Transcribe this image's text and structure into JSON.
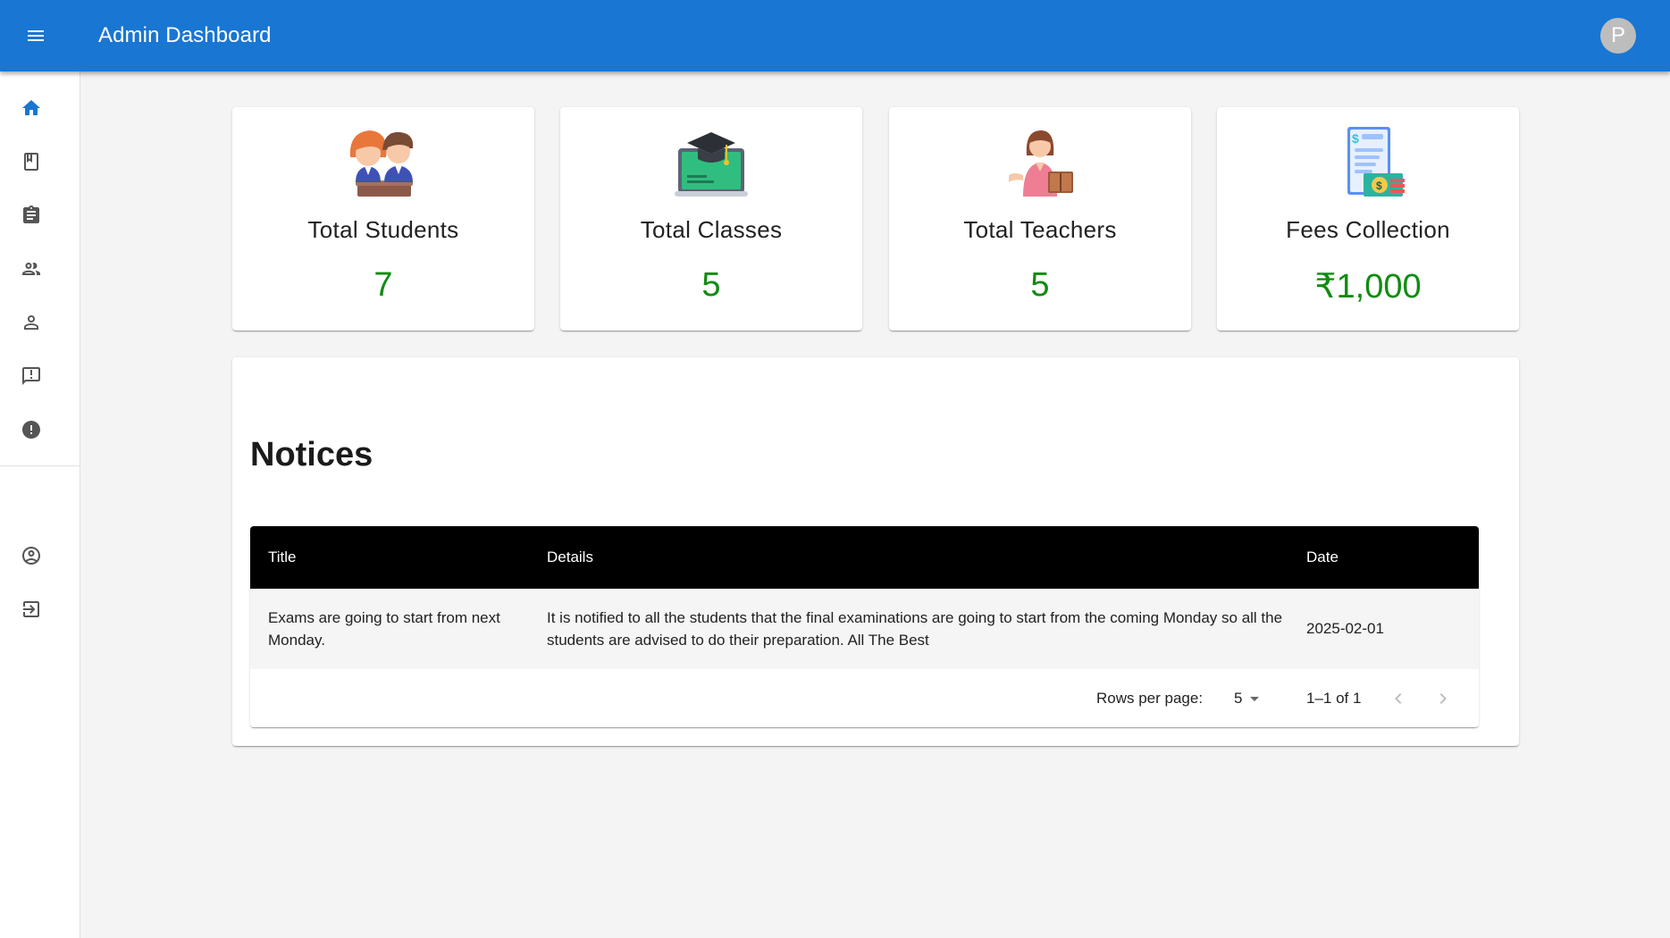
{
  "appbar": {
    "title": "Admin Dashboard",
    "avatar_initial": "P",
    "color": "#1976d2"
  },
  "sidebar": {
    "items": [
      {
        "name": "home",
        "icon": "home-icon",
        "active": true
      },
      {
        "name": "classes",
        "icon": "class-icon"
      },
      {
        "name": "subjects",
        "icon": "assignment-icon"
      },
      {
        "name": "teachers",
        "icon": "supervisor-icon"
      },
      {
        "name": "students",
        "icon": "person-icon"
      },
      {
        "name": "notices",
        "icon": "announcement-icon"
      },
      {
        "name": "complains",
        "icon": "report-icon"
      },
      {
        "name": "profile",
        "icon": "account-circle-icon"
      },
      {
        "name": "logout",
        "icon": "exit-icon"
      }
    ]
  },
  "stats": [
    {
      "label": "Total Students",
      "value": "7",
      "icon": "students-illustration"
    },
    {
      "label": "Total Classes",
      "value": "5",
      "icon": "classes-illustration"
    },
    {
      "label": "Total Teachers",
      "value": "5",
      "icon": "teacher-illustration"
    },
    {
      "label": "Fees Collection",
      "value": "₹1,000",
      "icon": "fees-illustration"
    }
  ],
  "notices": {
    "heading": "Notices",
    "columns": [
      "Title",
      "Details",
      "Date"
    ],
    "rows": [
      {
        "title": "Exams are going to start from next Monday.",
        "details": "It is notified to all the students that the final examinations are going to start from the coming Monday so all the students are advised to do their preparation. All The Best",
        "date": "2025-02-01"
      }
    ],
    "pagination": {
      "rows_per_page_label": "Rows per page:",
      "rows_per_page": "5",
      "range": "1–1 of 1"
    }
  },
  "colors": {
    "accent": "#1976d2",
    "stat_value": "#118c11",
    "table_header": "#000000"
  }
}
